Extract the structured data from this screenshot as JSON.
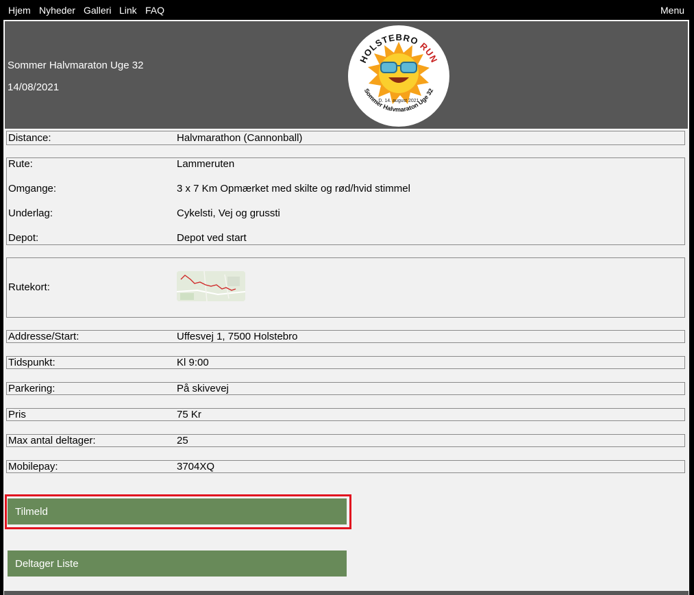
{
  "nav": {
    "items": [
      "Hjem",
      "Nyheder",
      "Galleri",
      "Link",
      "FAQ"
    ],
    "menu_label": "Menu"
  },
  "header": {
    "title": "Sommer Halvmaraton Uge 32",
    "date": "14/08/2021",
    "logo": {
      "top_text_1": "HOLSTEBRO",
      "top_text_2": "RUN",
      "date_text": "D. 14. august 2021",
      "bottom_text": "Sommer Halvmaraton Uge 32",
      "icon": "sun-with-sunglasses-icon"
    }
  },
  "details": {
    "distance": {
      "label": "Distance:",
      "value": "Halvmarathon (Cannonball)"
    },
    "route": [
      {
        "label": "Rute:",
        "value": "Lammeruten"
      },
      {
        "label": "Omgange:",
        "value": "3 x 7 Km Opmærket med skilte og rød/hvid stimmel"
      },
      {
        "label": "Underlag:",
        "value": "Cykelsti, Vej og grussti"
      },
      {
        "label": "Depot:",
        "value": "Depot ved start"
      }
    ],
    "map": {
      "label": "Rutekort:",
      "icon": "route-map-thumbnail"
    },
    "address": {
      "label": "Addresse/Start:",
      "value": "Uffesvej 1, 7500 Holstebro"
    },
    "time": {
      "label": "Tidspunkt:",
      "value": "Kl 9:00"
    },
    "parking": {
      "label": "Parkering:",
      "value": "På skivevej"
    },
    "price": {
      "label": "Pris",
      "value": "75 Kr"
    },
    "max_participants": {
      "label": "Max antal deltager:",
      "value": "25"
    },
    "mobilepay": {
      "label": "Mobilepay:",
      "value": "3704XQ"
    }
  },
  "buttons": {
    "signup": "Tilmeld",
    "participant_list": "Deltager Liste"
  },
  "colors": {
    "header_bg": "#575757",
    "button_bg": "#688a59",
    "highlight": "#e1131f",
    "page_bg": "#f1f1f1"
  }
}
